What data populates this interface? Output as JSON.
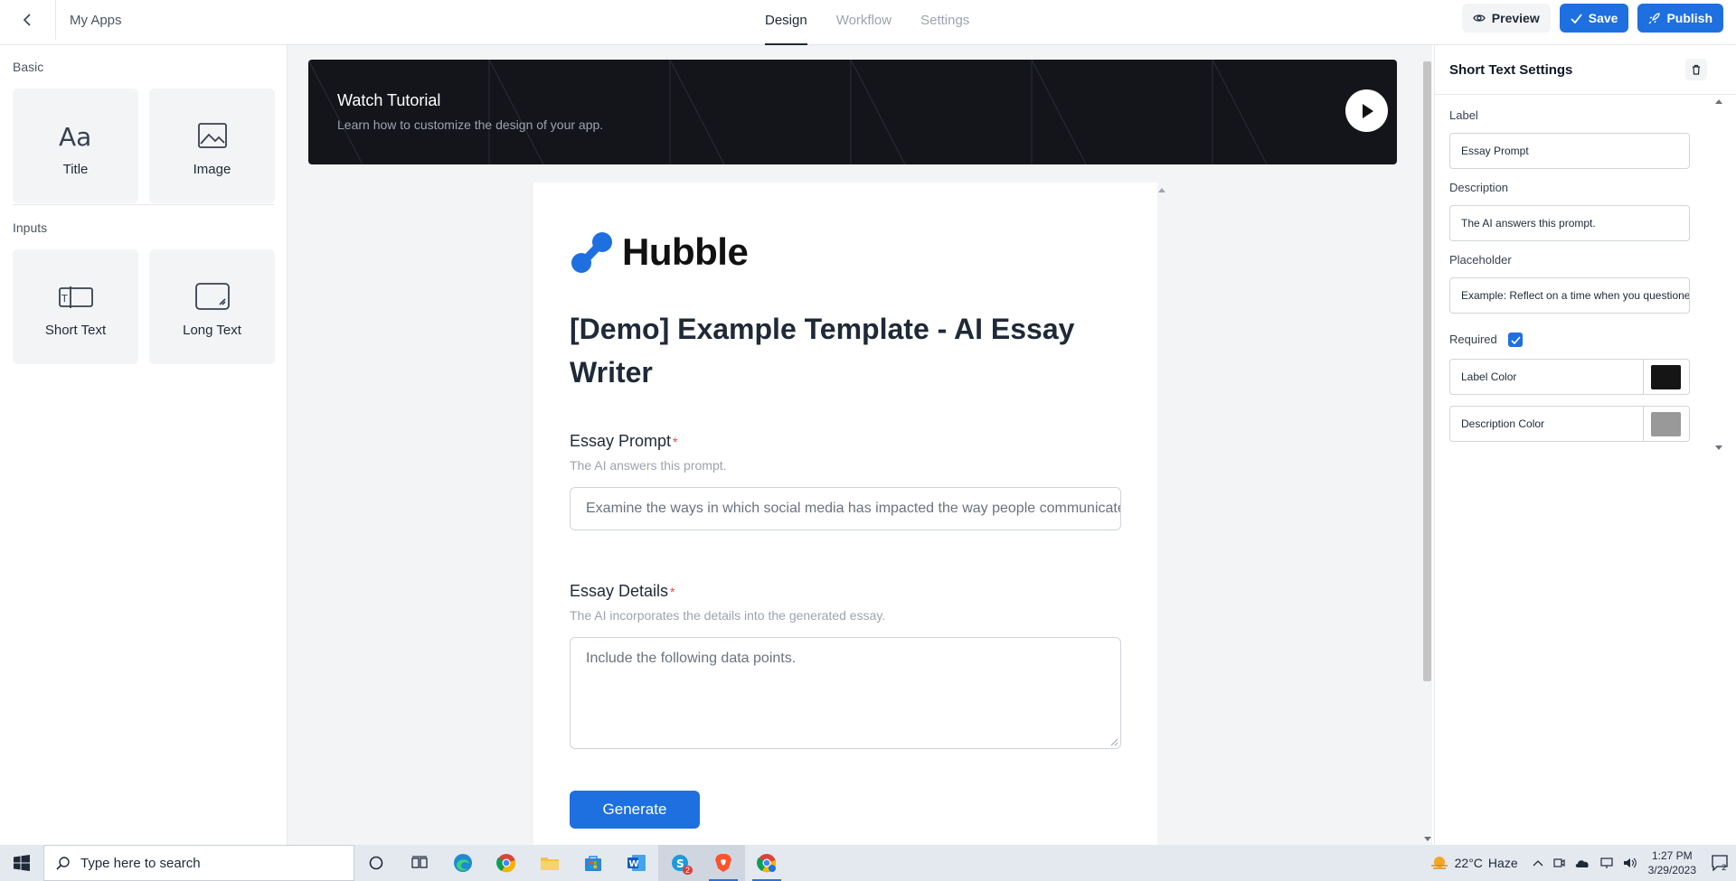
{
  "header": {
    "breadcrumb": "My Apps",
    "tabs": [
      {
        "label": "Design",
        "active": true
      },
      {
        "label": "Workflow",
        "active": false
      },
      {
        "label": "Settings",
        "active": false
      }
    ],
    "preview_label": "Preview",
    "save_label": "Save",
    "publish_label": "Publish"
  },
  "left_panel": {
    "basic_label": "Basic",
    "basic_blocks": [
      {
        "label": "Title",
        "icon": "title-icon"
      },
      {
        "label": "Image",
        "icon": "image-icon"
      }
    ],
    "inputs_label": "Inputs",
    "input_blocks": [
      {
        "label": "Short Text",
        "icon": "short-text-icon"
      },
      {
        "label": "Long Text",
        "icon": "long-text-icon"
      }
    ]
  },
  "tutorial": {
    "title": "Watch Tutorial",
    "subtitle": "Learn how to customize the design of your app."
  },
  "form": {
    "logo_text": "Hubble",
    "title": "[Demo] Example Template - AI Essay Writer",
    "fields": [
      {
        "label": "Essay Prompt",
        "required_mark": "*",
        "description": "The AI answers this prompt.",
        "placeholder": "Examine the ways in which social media has impacted the way people communicate."
      },
      {
        "label": "Essay Details",
        "required_mark": "*",
        "description": "The AI incorporates the details into the generated essay.",
        "placeholder": "Include the following data points."
      }
    ],
    "generate_label": "Generate"
  },
  "settings_panel": {
    "title": "Short Text Settings",
    "label_caption": "Label",
    "label_value": "Essay Prompt",
    "description_caption": "Description",
    "description_value": "The AI answers this prompt.",
    "placeholder_caption": "Placeholder",
    "placeholder_value": "Example: Reflect on a time when you questioned or challenged a belief or idea.",
    "required_caption": "Required",
    "required_checked": true,
    "label_color_caption": "Label Color",
    "label_color": "#151515",
    "description_color_caption": "Description Color",
    "description_color": "#999999"
  },
  "taskbar": {
    "search_placeholder": "Type here to search",
    "weather_temp": "22°C",
    "weather_text": "Haze",
    "time": "1:27 PM",
    "date": "3/29/2023",
    "notification_count": "2",
    "badge_count": "2"
  },
  "colors": {
    "accent": "#1e6fe0",
    "tutorial_bg": "#13151a",
    "required_star": "#ef4444"
  }
}
